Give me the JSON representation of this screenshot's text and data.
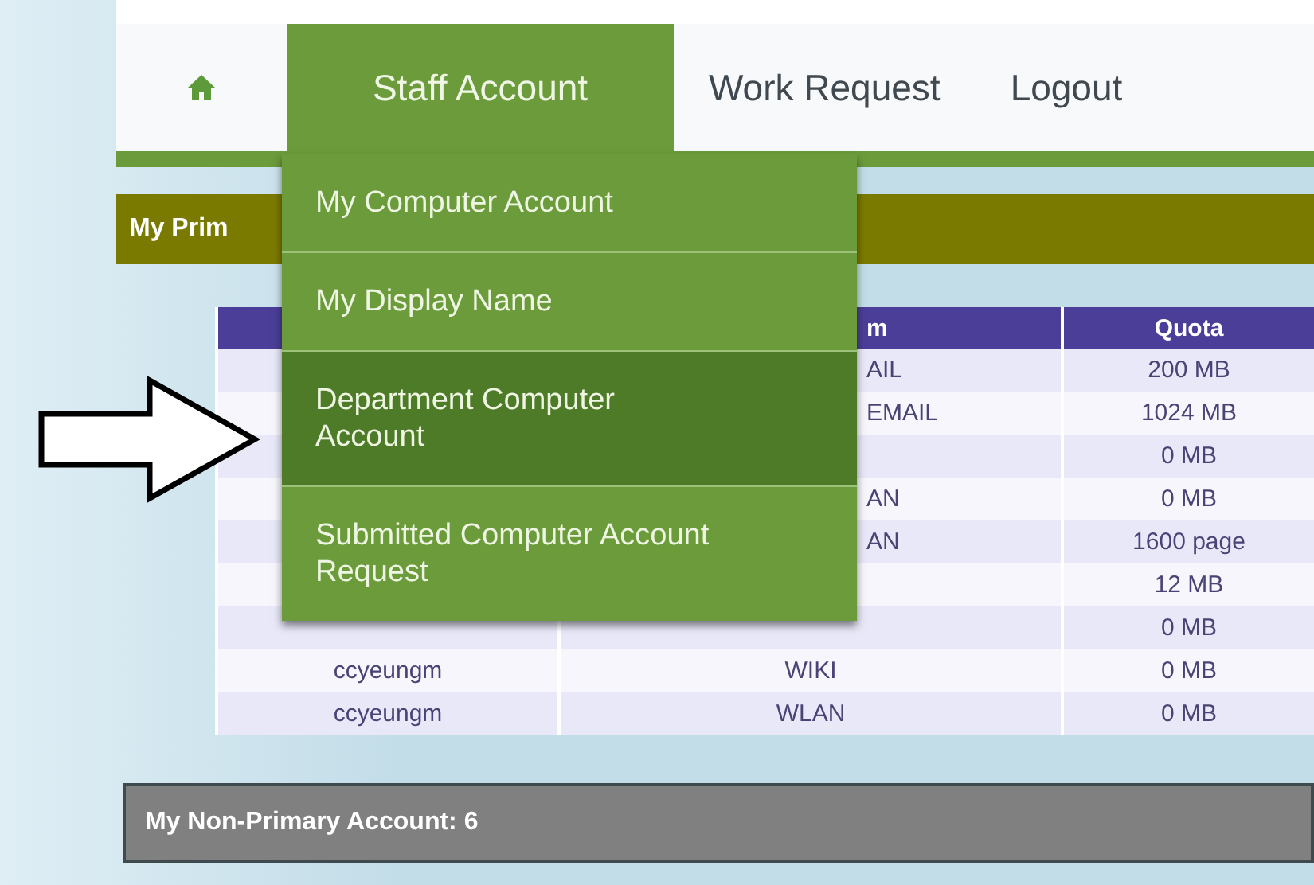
{
  "nav": {
    "items": [
      {
        "kind": "home",
        "selected": false
      },
      {
        "kind": "text",
        "label": "Staff Account",
        "selected": true
      },
      {
        "kind": "text",
        "label": "Work Request",
        "selected": false
      },
      {
        "kind": "text",
        "label": "Logout",
        "selected": false
      }
    ]
  },
  "dropdown": {
    "items": [
      {
        "label": "My Computer Account",
        "highlighted": false
      },
      {
        "label": "My Display Name",
        "highlighted": false
      },
      {
        "label": "Department Computer Account",
        "highlighted": true
      },
      {
        "label": "Submitted Computer Account Request",
        "highlighted": false
      }
    ]
  },
  "primary_section": {
    "title": "My Prim"
  },
  "table": {
    "columns": {
      "column_2": "m",
      "quota": "Quota"
    },
    "rows": [
      {
        "system": "AIL",
        "quota": "200 MB"
      },
      {
        "system": "EMAIL",
        "quota": "1024 MB"
      },
      {
        "quota": "0 MB"
      },
      {
        "system": "AN",
        "quota": "0 MB"
      },
      {
        "system": "AN",
        "quota": "1600 page"
      },
      {
        "quota": "12 MB"
      },
      {
        "quota": "0 MB"
      },
      {
        "account": "ccyeungm",
        "system": "WIKI",
        "quota": "0 MB"
      },
      {
        "account": "ccyeungm",
        "system": "WLAN",
        "quota": "0 MB"
      }
    ]
  },
  "non_primary_section": {
    "title": "My Non-Primary Account: 6"
  }
}
